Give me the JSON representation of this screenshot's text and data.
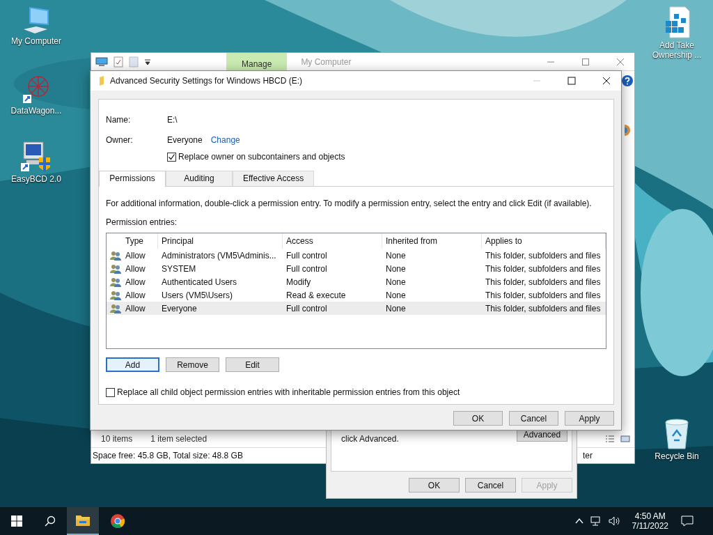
{
  "desktop_icons": [
    {
      "label": "My Computer",
      "kind": "computer"
    },
    {
      "label": "DataWagon...",
      "kind": "network"
    },
    {
      "label": "EasyBCD 2.0",
      "kind": "easybcd"
    },
    {
      "label": "Add Take Ownership ...",
      "kind": "registry"
    },
    {
      "label": "Recycle Bin",
      "kind": "recycle-bin"
    }
  ],
  "explorer": {
    "ribbon_tab": "Manage",
    "title": "My Computer",
    "item_count": "10 items",
    "selection": "1 item selected",
    "details": "Space free: 45.8 GB, Total size: 48.8 GB",
    "details_right": "ter"
  },
  "properties": {
    "text": "click Advanced.",
    "advanced_button": "Advanced",
    "buttons": [
      {
        "label": "OK",
        "disabled": false
      },
      {
        "label": "Cancel",
        "disabled": false
      },
      {
        "label": "Apply",
        "disabled": true
      }
    ]
  },
  "dialog": {
    "title": "Advanced Security Settings for Windows HBCD (E:)",
    "name_label": "Name:",
    "name_value": "E:\\",
    "owner_label": "Owner:",
    "owner_value": "Everyone",
    "change_link": "Change",
    "replace_owner": {
      "label": "Replace owner on subcontainers and objects",
      "checked": true
    },
    "tabs": [
      {
        "label": "Permissions",
        "selected": true
      },
      {
        "label": "Auditing",
        "selected": false
      },
      {
        "label": "Effective Access",
        "selected": false
      }
    ],
    "info": "For additional information, double-click a permission entry. To modify a permission entry, select the entry and click Edit (if available).",
    "entries_label": "Permission entries:",
    "table": {
      "columns": [
        "Type",
        "Principal",
        "Access",
        "Inherited from",
        "Applies to"
      ],
      "rows": [
        {
          "cells": [
            "Allow",
            "Administrators (VM5\\Adminis...",
            "Full control",
            "None",
            "This folder, subfolders and files"
          ],
          "selected": false
        },
        {
          "cells": [
            "Allow",
            "SYSTEM",
            "Full control",
            "None",
            "This folder, subfolders and files"
          ],
          "selected": false
        },
        {
          "cells": [
            "Allow",
            "Authenticated Users",
            "Modify",
            "None",
            "This folder, subfolders and files"
          ],
          "selected": false
        },
        {
          "cells": [
            "Allow",
            "Users (VM5\\Users)",
            "Read & execute",
            "None",
            "This folder, subfolders and files"
          ],
          "selected": false
        },
        {
          "cells": [
            "Allow",
            "Everyone",
            "Full control",
            "None",
            "This folder, subfolders and files"
          ],
          "selected": true
        }
      ]
    },
    "entry_buttons": [
      {
        "label": "Add",
        "default": true
      },
      {
        "label": "Remove",
        "default": false
      },
      {
        "label": "Edit",
        "default": false
      }
    ],
    "replace_child": {
      "label": "Replace all child object permission entries with inheritable permission entries from this object",
      "checked": false
    },
    "buttons": [
      {
        "label": "OK"
      },
      {
        "label": "Cancel"
      },
      {
        "label": "Apply"
      }
    ]
  },
  "taskbar": {
    "apps": [
      {
        "kind": "explorer",
        "selected": true
      },
      {
        "kind": "chrome",
        "selected": false
      }
    ],
    "time": "4:50 AM",
    "date": "7/11/2022"
  }
}
